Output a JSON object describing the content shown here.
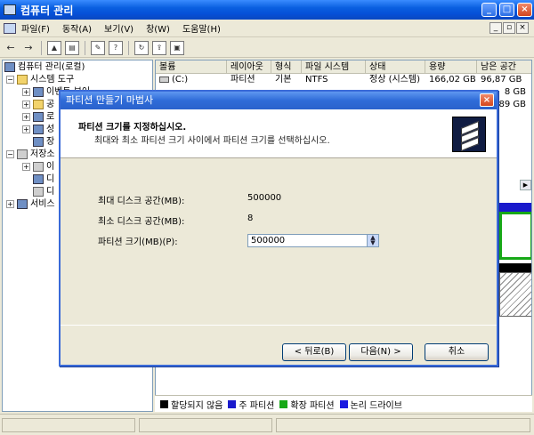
{
  "window": {
    "title": "컴퓨터 관리"
  },
  "menu": {
    "file": "파일(F)",
    "action": "동작(A)",
    "view": "보기(V)",
    "window": "창(W)",
    "help": "도움말(H)"
  },
  "mdi_controls": {
    "min": "_",
    "restore": "▫",
    "close": "×"
  },
  "toolbar": {
    "back": "←",
    "forward": "→"
  },
  "tree": {
    "root": "컴퓨터 관리(로컬)",
    "system_tools": "시스템 도구",
    "system_children": [
      "이벤트 뷰어",
      "공",
      "로",
      "성",
      "장"
    ],
    "storage": "저장소",
    "storage_children": [
      "이",
      "디",
      "디"
    ],
    "services": "서비스"
  },
  "list": {
    "columns": [
      "볼륨",
      "레이아웃",
      "형식",
      "파일 시스템",
      "상태",
      "용량",
      "남은 공간"
    ],
    "rows": [
      {
        "volume": "(C:)",
        "layout": "파티션",
        "type": "기본",
        "fs": "NTFS",
        "status": "정상 (시스템)",
        "capacity": "166,02 GB",
        "free": "96,87 GB"
      }
    ],
    "partial_free": [
      "8 GB",
      "89 GB"
    ]
  },
  "legend": {
    "items": [
      {
        "label": "할당되지 않음",
        "color": "#000000"
      },
      {
        "label": "주 파티션",
        "color": "#1a1acc"
      },
      {
        "label": "확장 파티션",
        "color": "#17a817"
      },
      {
        "label": "논리 드라이브",
        "color": "#1a1ae0"
      }
    ]
  },
  "wizard": {
    "title": "파티션 만들기 마법사",
    "heading": "파티션 크기를 지정하십시오.",
    "subheading": "최대와 최소 파티션 크기 사이에서 파티션 크기를 선택하십시오.",
    "max_label": "최대 디스크 공간(MB):",
    "max_value": "500000",
    "min_label": "최소 디스크 공간(MB):",
    "min_value": "8",
    "size_label": "파티션 크기(MB)(P):",
    "size_value": "500000",
    "back_button": "< 뒤로(B)",
    "next_button": "다음(N) >",
    "cancel_button": "취소"
  }
}
